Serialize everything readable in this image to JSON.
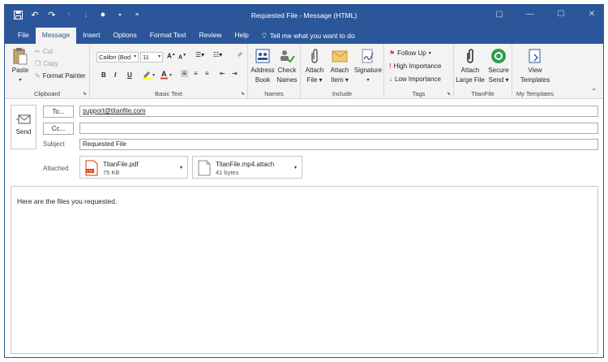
{
  "window": {
    "title": "Requested File - Message (HTML)",
    "controls": [
      "▢",
      "—",
      "☐",
      "✕"
    ]
  },
  "tabs": [
    "File",
    "Message",
    "Insert",
    "Options",
    "Format Text",
    "Review",
    "Help"
  ],
  "active_tab": "Message",
  "tell_me": "Tell me what you want to do",
  "ribbon": {
    "clipboard": {
      "paste": "Paste",
      "cut": "Cut",
      "copy": "Copy",
      "format_painter": "Format Painter",
      "label": "Clipboard"
    },
    "basic_text": {
      "font": "Calibri (Bod",
      "size": "11",
      "bold": "B",
      "italic": "I",
      "underline": "U",
      "label": "Basic Text"
    },
    "names": {
      "address_book": [
        "Address",
        "Book"
      ],
      "check_names": [
        "Check",
        "Names"
      ],
      "label": "Names"
    },
    "include": {
      "attach_file": [
        "Attach",
        "File"
      ],
      "attach_item": [
        "Attach",
        "Item"
      ],
      "signature": "Signature",
      "label": "Include"
    },
    "tags": {
      "follow_up": "Follow Up",
      "high_importance": "High Importance",
      "low_importance": "Low Importance",
      "label": "Tags"
    },
    "titanfile": {
      "attach_large": [
        "Attach",
        "Large File"
      ],
      "secure_send": [
        "Secure",
        "Send"
      ],
      "label": "TitanFile"
    },
    "my_templates": {
      "view_templates": [
        "View",
        "Templates"
      ],
      "label": "My Templates"
    }
  },
  "compose": {
    "send": "Send",
    "to_button": "To...",
    "cc_button": "Cc...",
    "to_value": "support@titanfile.com",
    "cc_value": "",
    "subject_label": "Subject",
    "subject_value": "Requested File",
    "attached_label": "Attached",
    "attachments": [
      {
        "name": "TitanFile.pdf",
        "size": "75 KB",
        "type": "pdf"
      },
      {
        "name": "TitanFile.mp4.attach",
        "size": "41 bytes",
        "type": "generic"
      }
    ],
    "body_text": "Here are the files you requested."
  },
  "colors": {
    "accent": "#2b579a",
    "ribbon_bg": "#f3f3f3",
    "pdf_red": "#d83b01",
    "titan_green": "#2e9e4a",
    "flag_red": "#e03c31",
    "low_blue": "#2b579a"
  }
}
